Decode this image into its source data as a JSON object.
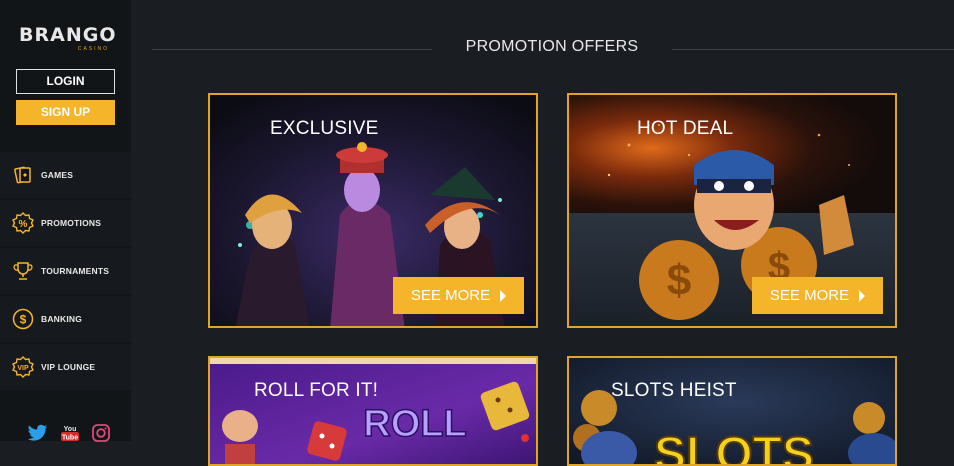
{
  "brand": {
    "logo": "BRANGO",
    "logo_sub": "CASINO"
  },
  "auth": {
    "login_label": "LOGIN",
    "signup_label": "SIGN UP"
  },
  "nav": {
    "items": [
      {
        "label": "GAMES",
        "icon": "cards-icon"
      },
      {
        "label": "PROMOTIONS",
        "icon": "percent-badge-icon"
      },
      {
        "label": "TOURNAMENTS",
        "icon": "trophy-icon"
      },
      {
        "label": "BANKING",
        "icon": "dollar-coin-icon"
      },
      {
        "label": "VIP LOUNGE",
        "icon": "vip-badge-icon"
      }
    ]
  },
  "social": [
    "twitter-icon",
    "youtube-icon",
    "instagram-icon"
  ],
  "page": {
    "title": "PROMOTION OFFERS"
  },
  "promos": [
    {
      "title": "EXCLUSIVE",
      "cta": "SEE MORE"
    },
    {
      "title": "HOT DEAL",
      "cta": "SEE MORE"
    },
    {
      "title": "ROLL FOR IT!"
    },
    {
      "title": "SLOTS HEIST"
    }
  ],
  "colors": {
    "accent": "#f4b52a",
    "card_border": "#e0a526",
    "sidebar_bg": "#121518",
    "page_bg": "#1a1d22"
  }
}
